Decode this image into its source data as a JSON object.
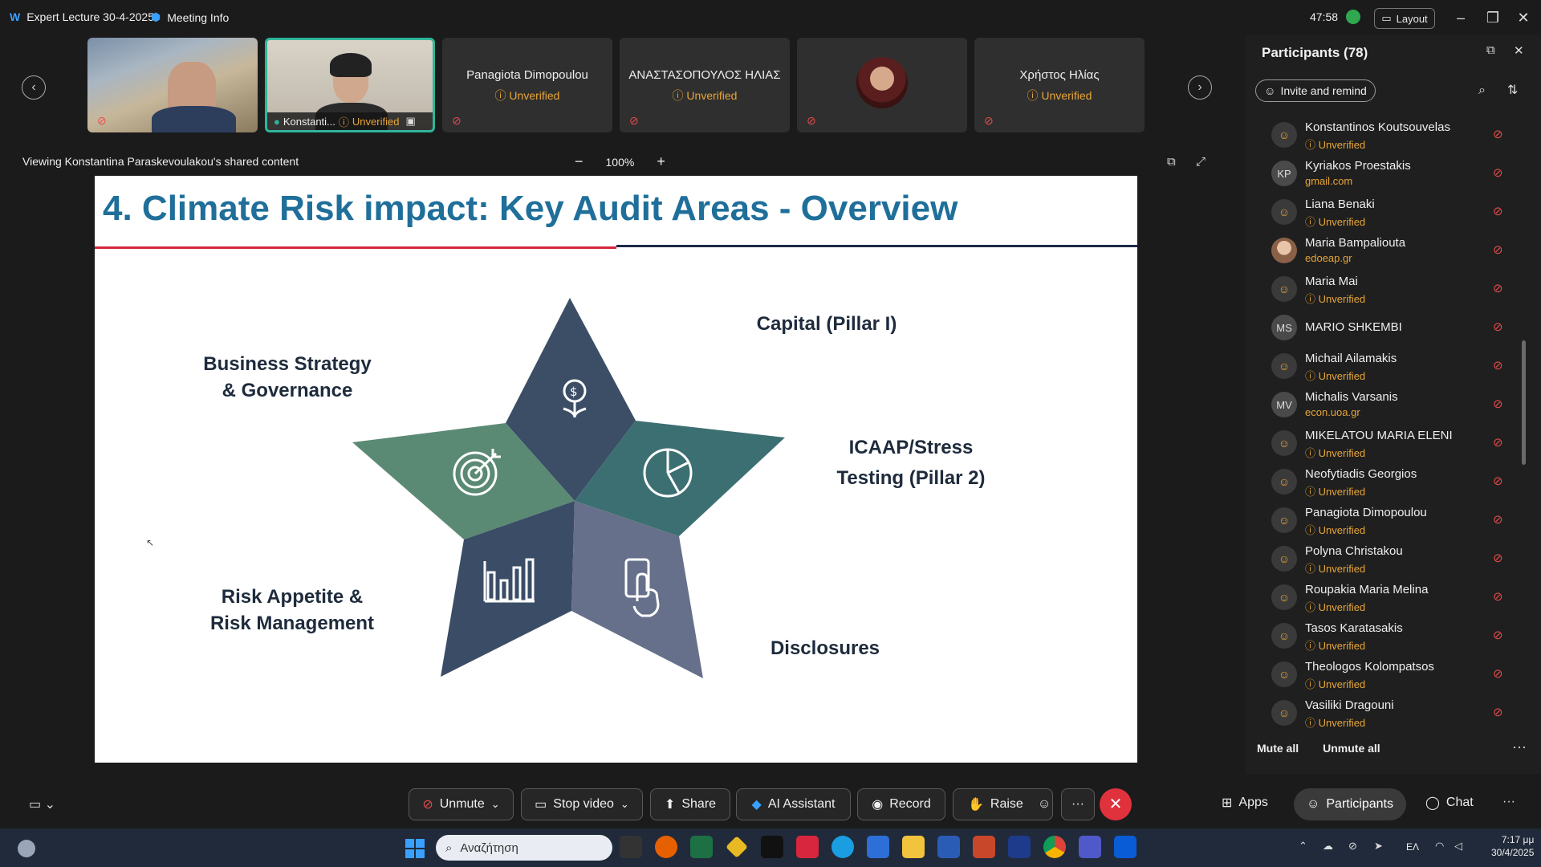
{
  "titlebar": {
    "app_title": "Expert Lecture 30-4-2025",
    "meeting_info": "Meeting Info",
    "timer": "47:58",
    "layout_label": "Layout"
  },
  "video_strip": {
    "tiles": [
      {
        "name": "",
        "status": ""
      },
      {
        "name": "Konstanti...",
        "status": "Unverified"
      },
      {
        "name": "Panagiota Dimopoulou",
        "status": "Unverified"
      },
      {
        "name": "ΑΝΑΣΤΑΣΟΠΟΥΛΟΣ ΗΛΙΑΣ",
        "status": "Unverified"
      },
      {
        "name": "",
        "status": ""
      },
      {
        "name": "Χρήστος Ηλίας",
        "status": "Unverified"
      }
    ]
  },
  "share": {
    "viewing_text": "Viewing Konstantina Paraskevoulakou's shared content",
    "zoom_level": "100%",
    "zoom_out": "−",
    "zoom_in": "+"
  },
  "slide": {
    "title": "4. Climate Risk impact: Key Audit Areas - Overview",
    "labels": {
      "capital": "Capital (Pillar I)",
      "business_1": "Business Strategy",
      "business_2": "& Governance",
      "icaap_1": "ICAAP/Stress",
      "icaap_2": "Testing (Pillar 2)",
      "risk_1": "Risk Appetite &",
      "risk_2": "Risk Management",
      "disclosures": "Disclosures"
    },
    "colors": {
      "title": "#1f6f9a",
      "top_segment": "#3c4e66",
      "left_segment": "#5b8a74",
      "right_segment": "#3c6f72",
      "bottom_left_segment": "#3b4d66",
      "bottom_right_segment": "#66708a"
    }
  },
  "participants": {
    "title": "Participants (78)",
    "invite_label": "Invite and remind",
    "mute_all": "Mute all",
    "unmute_all": "Unmute all",
    "list": [
      {
        "name": "Konstantinos Koutsouvelas",
        "sub": "Unverified",
        "avatar": "icon"
      },
      {
        "name": "Kyriakos Proestakis",
        "sub": "gmail.com",
        "avatar": "KP"
      },
      {
        "name": "Liana Benaki",
        "sub": "Unverified",
        "avatar": "icon"
      },
      {
        "name": "Maria Bampaliouta",
        "sub": "edoeap.gr",
        "avatar": "photo"
      },
      {
        "name": "Maria Mai",
        "sub": "Unverified",
        "avatar": "icon"
      },
      {
        "name": "MARIO SHKEMBI",
        "sub": "",
        "avatar": "MS"
      },
      {
        "name": "Michail Ailamakis",
        "sub": "Unverified",
        "avatar": "icon"
      },
      {
        "name": "Michalis Varsanis",
        "sub": "econ.uoa.gr",
        "avatar": "MV"
      },
      {
        "name": "MIKELATOU MARIA ELENI",
        "sub": "Unverified",
        "avatar": "icon"
      },
      {
        "name": "Neofytiadis Georgios",
        "sub": "Unverified",
        "avatar": "icon"
      },
      {
        "name": "Panagiota Dimopoulou",
        "sub": "Unverified",
        "avatar": "icon"
      },
      {
        "name": "Polyna Christakou",
        "sub": "Unverified",
        "avatar": "icon"
      },
      {
        "name": "Roupakia Maria Melina",
        "sub": "Unverified",
        "avatar": "icon"
      },
      {
        "name": "Tasos Karatasakis",
        "sub": "Unverified",
        "avatar": "icon"
      },
      {
        "name": "Theologos Kolompatsos",
        "sub": "Unverified",
        "avatar": "icon"
      },
      {
        "name": "Vasiliki Dragouni",
        "sub": "Unverified",
        "avatar": "icon"
      }
    ]
  },
  "toolbar": {
    "unmute": "Unmute",
    "stop_video": "Stop video",
    "share": "Share",
    "ai_assistant": "AI Assistant",
    "record": "Record",
    "raise": "Raise",
    "more": "···",
    "apps": "Apps",
    "participants": "Participants",
    "chat": "Chat"
  },
  "taskbar": {
    "search_placeholder": "Αναζήτηση",
    "language": "ΕΛ",
    "time": "7:17 μμ",
    "date": "30/4/2025"
  }
}
